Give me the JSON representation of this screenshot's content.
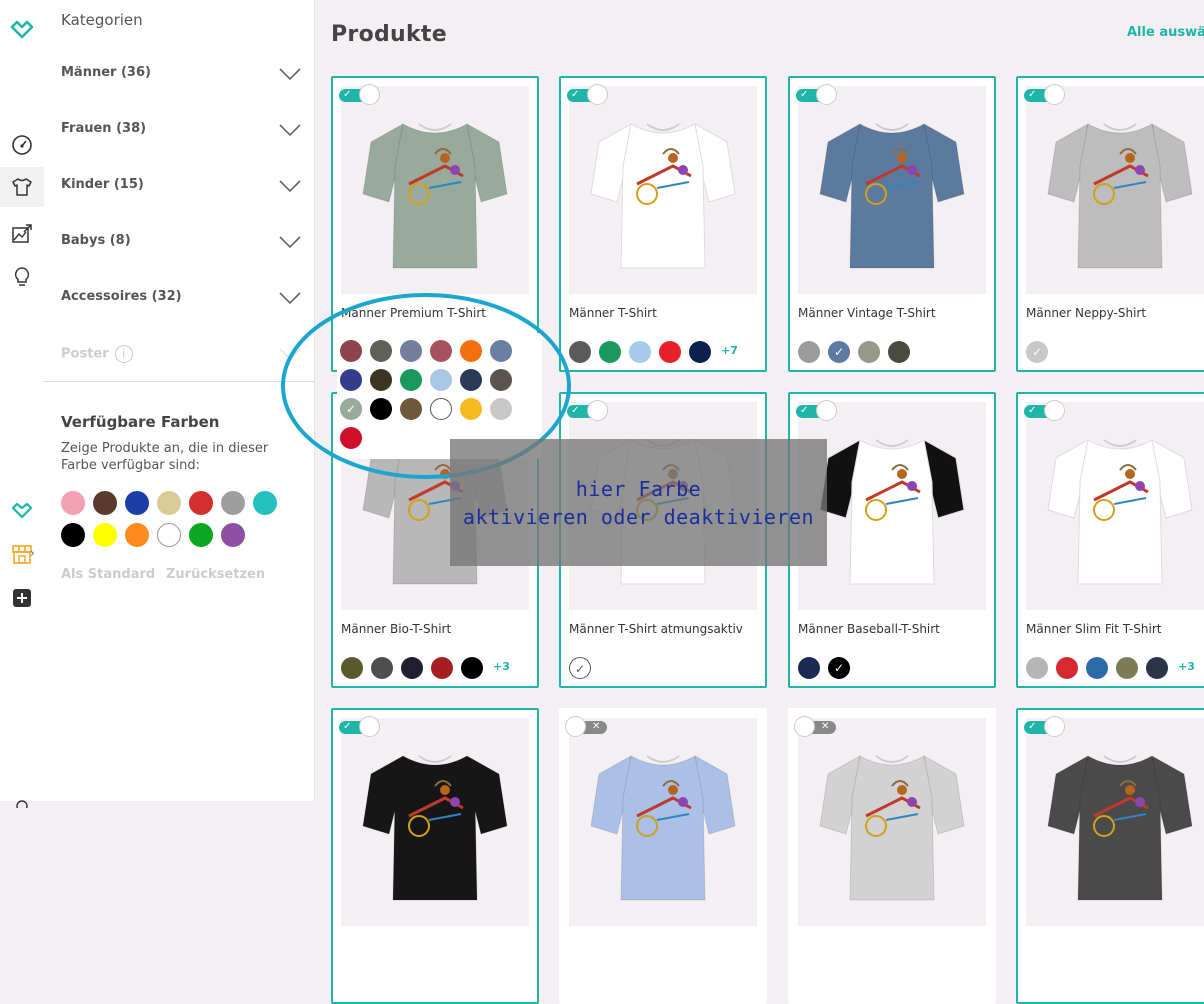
{
  "categories_panel": {
    "title": "Kategorien",
    "items": [
      {
        "label": "Männer (36)"
      },
      {
        "label": "Frauen (38)"
      },
      {
        "label": "Kinder (15)"
      },
      {
        "label": "Babys (8)"
      },
      {
        "label": "Accessoires (32)"
      },
      {
        "label": "Poster",
        "disabled": true
      }
    ],
    "colors_title": "Verfügbare Farben",
    "colors_desc": "Zeige Produkte an, die in dieser Farbe verfügbar sind:",
    "filter_colors": [
      "#f4a0b3",
      "#5a3a2a",
      "#1a3fa8",
      "#d9cb96",
      "#d32f2f",
      "#9e9e9e",
      "#26bfbf",
      "#000000",
      "#ffff00",
      "#ff8a20",
      "#ffffff",
      "#0aa820",
      "#8e4fa3"
    ],
    "set_default_label": "Als Standard",
    "reset_label": "Zurücksetzen"
  },
  "main": {
    "title": "Produkte",
    "select_all": "Alle auswäh"
  },
  "products": [
    {
      "name": "Männer Premium T-Shirt",
      "enabled": true,
      "shirt": "#98aa9c",
      "swatches": []
    },
    {
      "name": "Männer T-Shirt",
      "enabled": true,
      "shirt": "#ffffff",
      "swatches": [
        "#5a5a5a",
        "#1a9a5a",
        "#a7c9ea",
        "#e8202a",
        "#0c2050"
      ],
      "more": "+7"
    },
    {
      "name": "Männer Vintage T-Shirt",
      "enabled": true,
      "shirt": "#5b7a9e",
      "swatches": [
        "#9c9c9c",
        "#5d7aa3",
        "#979a88",
        "#4a4b40"
      ],
      "checked": 1
    },
    {
      "name": "Männer Neppy-Shirt",
      "enabled": true,
      "shirt": "#bdbdbd",
      "swatches": [
        "#c8c8c8"
      ],
      "checked": 0
    },
    {
      "name": "Männer Bio-T-Shirt",
      "enabled": true,
      "shirt": "#b8b8b8",
      "swatches": [
        "#5a5a2a",
        "#4d4f4d",
        "#1f1f2f",
        "#a51e22",
        "#000000"
      ],
      "more": "+3"
    },
    {
      "name": "Männer T-Shirt atmungsaktiv",
      "enabled": true,
      "shirt": "#ffffff",
      "swatches": [
        "#ffffff"
      ],
      "checked": 0
    },
    {
      "name": "Männer Baseball-T-Shirt",
      "enabled": true,
      "shirt": "#ffffff",
      "sleeves": "#111111",
      "swatches": [
        "#1a2a52",
        "#000000"
      ],
      "checked": 1
    },
    {
      "name": "Männer Slim Fit T-Shirt",
      "enabled": true,
      "shirt": "#ffffff",
      "swatches": [
        "#b5b5b5",
        "#d62a30",
        "#2f6aa8",
        "#7b7b55",
        "#2b3447"
      ],
      "more": "+3"
    },
    {
      "name": "",
      "enabled": true,
      "shirt": "#161616",
      "swatches": []
    },
    {
      "name": "",
      "enabled": false,
      "shirt": "#aac0e6",
      "swatches": []
    },
    {
      "name": "",
      "enabled": false,
      "shirt": "#d2d2d2",
      "swatches": []
    },
    {
      "name": "",
      "enabled": true,
      "shirt": "#4a4a4a",
      "swatches": []
    }
  ],
  "popup_colors": [
    "#8e444c",
    "#5f6058",
    "#757e9a",
    "#a8525f",
    "#f3700f",
    "#6b80a0",
    "#333d8b",
    "#3a3420",
    "#1a9a5a",
    "#a9c8e8",
    "#2b3a55",
    "#5a564f",
    "#98aa9c",
    "#000000",
    "#6e5a3a",
    "#ffffff",
    "#f7b820",
    "#c8c8c8",
    "#d0102a"
  ],
  "popup_checked_index": 12,
  "annotation": {
    "line1": "hier Farbe",
    "line2": "aktivieren oder deaktivieren"
  }
}
